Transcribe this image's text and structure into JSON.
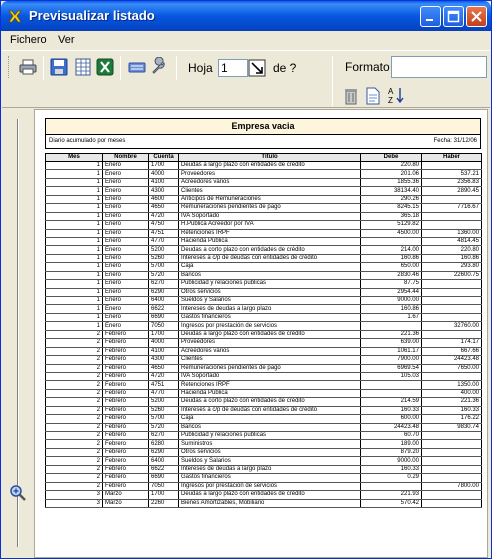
{
  "window": {
    "title": "Previsualizar listado"
  },
  "menu": {
    "items": [
      "Fichero",
      "Ver"
    ]
  },
  "toolbar": {
    "hoja_label": "Hoja",
    "hoja_value": "1",
    "de_label": "de ?",
    "formato_label": "Formato",
    "formato_value": ""
  },
  "report": {
    "company": "Empresa vacia",
    "subtitle": "Diario acumulado por meses",
    "date_label": "Fecha: 31/12/06",
    "columns": [
      "Mes",
      "Nombre",
      "Cuenta",
      "Título",
      "Debe",
      "Haber"
    ],
    "rows": [
      [
        "1",
        "Enero",
        "1700",
        "Deudas a largo plazo con entidades de crédito",
        "220.80",
        ""
      ],
      [
        "1",
        "Enero",
        "4000",
        "Proveedores",
        "201.06",
        "537.21"
      ],
      [
        "1",
        "Enero",
        "4100",
        "Acreedores varios",
        "1855.36",
        "2356.83"
      ],
      [
        "1",
        "Enero",
        "4300",
        "Clientes",
        "38134.40",
        "2890.45"
      ],
      [
        "1",
        "Enero",
        "4600",
        "Anticipos de Remuneraciones",
        "290.26",
        ""
      ],
      [
        "1",
        "Enero",
        "4650",
        "Remuneraciones pendientes de pago",
        "8245.15",
        "7716.67"
      ],
      [
        "1",
        "Enero",
        "4720",
        "IVA Soportado",
        "365.18",
        ""
      ],
      [
        "1",
        "Enero",
        "4750",
        "H.Publica Acreedor por IVA",
        "5129.82",
        ""
      ],
      [
        "1",
        "Enero",
        "4751",
        "Retenciones IRPF",
        "4500.00",
        "1360.00"
      ],
      [
        "1",
        "Enero",
        "4770",
        "Hacienda Pública",
        "",
        "4814.45"
      ],
      [
        "1",
        "Enero",
        "5200",
        "Deudas a corto plazo con entidades de crédito",
        "214.00",
        "220.80"
      ],
      [
        "1",
        "Enero",
        "5260",
        "Intereses a c/p de deudas con entidades de crédito",
        "160.86",
        "160.86"
      ],
      [
        "1",
        "Enero",
        "5700",
        "Caja",
        "650.00",
        "293.80"
      ],
      [
        "1",
        "Enero",
        "5720",
        "Bancos",
        "2830.46",
        "22600.75"
      ],
      [
        "1",
        "Enero",
        "6270",
        "Publicidad y relaciones publicas",
        "87.75",
        ""
      ],
      [
        "1",
        "Enero",
        "6290",
        "Otros servicios",
        "2954.44",
        ""
      ],
      [
        "1",
        "Enero",
        "6400",
        "Sueldos y Salarios",
        "9000.00",
        ""
      ],
      [
        "1",
        "Enero",
        "6622",
        "Intereses de deudas a largo plazo",
        "160.86",
        ""
      ],
      [
        "1",
        "Enero",
        "6690",
        "Gastos financieros",
        "1.67",
        ""
      ],
      [
        "1",
        "Enero",
        "7050",
        "Ingresos por prestación de servicios",
        "",
        "32760.00"
      ],
      [
        "2",
        "Febrero",
        "1700",
        "Deudas a largo plazo con entidades de crédito",
        "221.36",
        ""
      ],
      [
        "2",
        "Febrero",
        "4000",
        "Proveedores",
        "639.00",
        "174.17"
      ],
      [
        "2",
        "Febrero",
        "4100",
        "Acreedores varios",
        "1061.17",
        "667.66"
      ],
      [
        "2",
        "Febrero",
        "4300",
        "Clientes",
        "7900.00",
        "24423.48"
      ],
      [
        "2",
        "Febrero",
        "4650",
        "Remuneraciones pendientes de pago",
        "6969.54",
        "7650.00"
      ],
      [
        "2",
        "Febrero",
        "4720",
        "IVA Soportado",
        "105.03",
        ""
      ],
      [
        "2",
        "Febrero",
        "4751",
        "Retenciones IRPF",
        "",
        "1350.00"
      ],
      [
        "2",
        "Febrero",
        "4770",
        "Hacienda Pública",
        "",
        "400.00"
      ],
      [
        "2",
        "Febrero",
        "5200",
        "Deudas a corto plazo con entidades de crédito",
        "214.59",
        "221.36"
      ],
      [
        "2",
        "Febrero",
        "5260",
        "Intereses a c/p de deudas con entidades de crédito",
        "160.33",
        "160.33"
      ],
      [
        "2",
        "Febrero",
        "5700",
        "Caja",
        "600.00",
        "176.22"
      ],
      [
        "2",
        "Febrero",
        "5720",
        "Bancos",
        "24423.48",
        "9830.74"
      ],
      [
        "2",
        "Febrero",
        "6270",
        "Publicidad y relaciones publicas",
        "60.70",
        ""
      ],
      [
        "2",
        "Febrero",
        "6280",
        "Suministros",
        "189.00",
        ""
      ],
      [
        "2",
        "Febrero",
        "6290",
        "Otros servicios",
        "879.20",
        ""
      ],
      [
        "2",
        "Febrero",
        "6400",
        "Sueldos y Salarios",
        "9000.00",
        ""
      ],
      [
        "2",
        "Febrero",
        "6622",
        "Intereses de deudas a largo plazo",
        "160.33",
        ""
      ],
      [
        "2",
        "Febrero",
        "6690",
        "Gastos financieros",
        "0.29",
        ""
      ],
      [
        "2",
        "Febrero",
        "7050",
        "Ingresos por prestación de servicios",
        "",
        "7800.00"
      ],
      [
        "3",
        "Marzo",
        "1700",
        "Deudas a largo plazo con entidades de crédito",
        "221.93",
        ""
      ],
      [
        "3",
        "Marzo",
        "2260",
        "Bienes Amortizables, Mobiliario",
        "570.42",
        ""
      ]
    ]
  }
}
